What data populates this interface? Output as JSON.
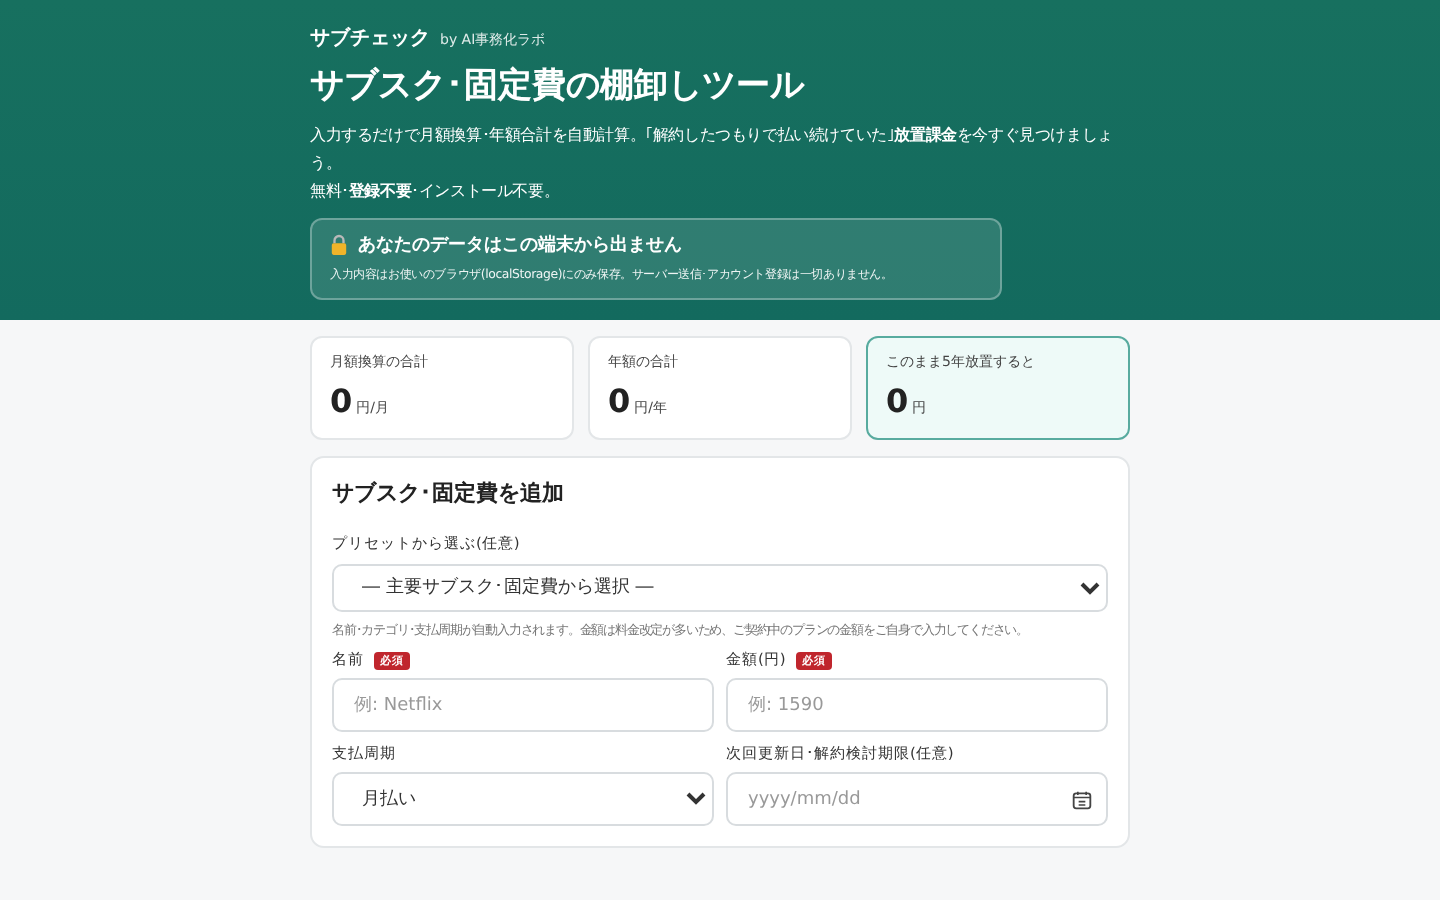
{
  "header": {
    "brand": "サブチェック",
    "byline": "by AI事務化ラボ",
    "title": "サブスク･固定費の棚卸しツール",
    "lede": "入力するだけで月額換算･年額合計を自動計算。｢解約したつもりで払い続けていた｣**放置課金**を今すぐ見つけましょう。",
    "note": "無料･**登録不要**･インストール不要。",
    "privacy": {
      "title": "あなたのデータはこの端末から出ません",
      "text": "入力内容はお使いのブラウザ(localStorage)にのみ保存。サーバー送信･アカウント登録は一切ありません。"
    }
  },
  "stats": [
    {
      "label": "月額換算の合計",
      "value": "0",
      "unit": "円/月",
      "highlight": false
    },
    {
      "label": "年額の合計",
      "value": "0",
      "unit": "円/年",
      "highlight": false
    },
    {
      "label": "このまま5年放置すると",
      "value": "0",
      "unit": "円",
      "highlight": true
    }
  ],
  "form": {
    "title": "サブスク･固定費を追加",
    "preset": {
      "label": "プリセットから選ぶ(任意)",
      "value": "― 主要サブスク･固定費から選択 ―",
      "hint": "名前･カテゴリ･支払周期が自動入力されます。金額は料金改定が多いため、ご契約中のプランの金額をご自身で入力してください。"
    },
    "fields": [
      {
        "kind": "text",
        "label": "名前",
        "badge": "必須",
        "placeholder": "例: Netflix"
      },
      {
        "kind": "text",
        "label": "金額(円)",
        "badge": "必須",
        "placeholder": "例: 1590"
      },
      {
        "kind": "select",
        "label": "支払周期",
        "value": "月払い"
      },
      {
        "kind": "date",
        "label": "次回更新日･解約検討期限(任意)",
        "placeholder": "yyyy/mm/dd"
      }
    ]
  }
}
